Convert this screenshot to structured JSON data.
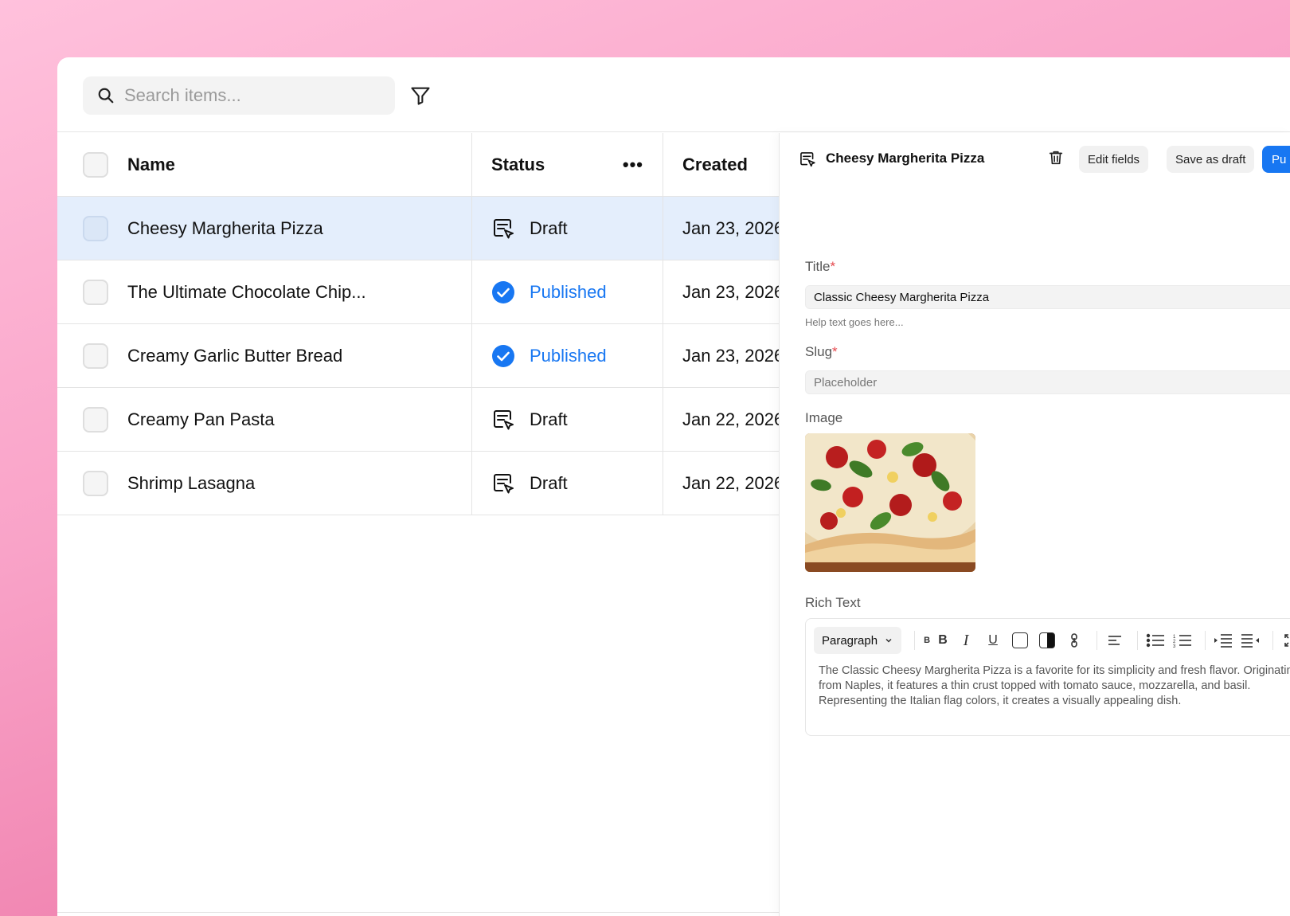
{
  "search": {
    "placeholder": "Search items..."
  },
  "table": {
    "columns": {
      "name": "Name",
      "status": "Status",
      "created": "Created"
    },
    "rows": [
      {
        "name": "Cheesy Margherita Pizza",
        "status": "Draft",
        "created": "Jan 23, 2026"
      },
      {
        "name": "The Ultimate Chocolate Chip...",
        "status": "Published",
        "created": "Jan 23, 2026"
      },
      {
        "name": "Creamy Garlic Butter Bread",
        "status": "Published",
        "created": "Jan 23, 2026"
      },
      {
        "name": "Creamy Pan Pasta",
        "status": "Draft",
        "created": "Jan 22, 2026"
      },
      {
        "name": "Shrimp Lasagna",
        "status": "Draft",
        "created": "Jan 22, 2026"
      }
    ]
  },
  "panel": {
    "title": "Cheesy Margherita Pizza",
    "edit_fields": "Edit fields",
    "save_draft": "Save as draft",
    "publish": "Pu",
    "title_label": "Title",
    "title_value": "Classic Cheesy Margherita Pizza",
    "help_text": "Help text goes here...",
    "slug_label": "Slug",
    "slug_placeholder": "Placeholder",
    "image_label": "Image",
    "rich_text_label": "Rich Text",
    "paragraph_option": "Paragraph",
    "rich_text_body": "The Classic Cheesy Margherita Pizza is a favorite for its simplicity and fresh flavor. Originating from Naples, it features a thin crust topped with tomato sauce, mozzarella, and basil. Representing the Italian flag colors, it creates a visually appealing dish.",
    "required_mark": "*",
    "bold_small": "B",
    "bold": "B",
    "italic": "I",
    "underline": "U"
  },
  "colors": {
    "accent": "#1877f2",
    "selected_row": "#e4eefc",
    "required": "#e5484d"
  }
}
